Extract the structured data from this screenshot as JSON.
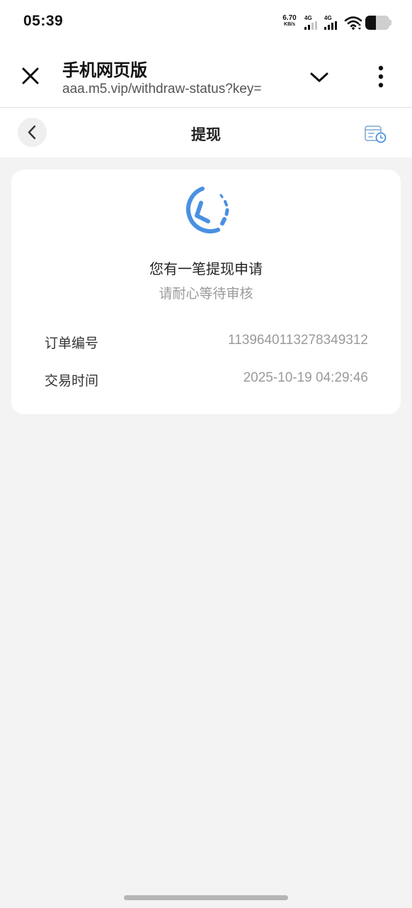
{
  "status_bar": {
    "time": "05:39",
    "net_speed_value": "6.70",
    "net_speed_unit": "KB/s",
    "signal_1_label": "4G",
    "signal_2_label": "4G",
    "battery_level": 0.45
  },
  "browser": {
    "title": "手机网页版",
    "url": "aaa.m5.vip/withdraw-status?key="
  },
  "page": {
    "title": "提现"
  },
  "card": {
    "status_title": "您有一笔提现申请",
    "status_subtitle": "请耐心等待审核",
    "rows": [
      {
        "label": "订单编号",
        "value": "1139640113278349312"
      },
      {
        "label": "交易时间",
        "value": "2025-10-19 04:29:46"
      }
    ]
  },
  "colors": {
    "accent": "#4a90e2",
    "page_bg": "#f3f3f3",
    "card_bg": "#ffffff",
    "muted_text": "#9a9a9a"
  },
  "icons": {
    "close": "close-icon",
    "dropdown": "chevron-down-icon",
    "more": "more-vertical-icon",
    "back": "chevron-left-icon",
    "records": "record-clock-icon",
    "status": "pending-clock-icon"
  }
}
